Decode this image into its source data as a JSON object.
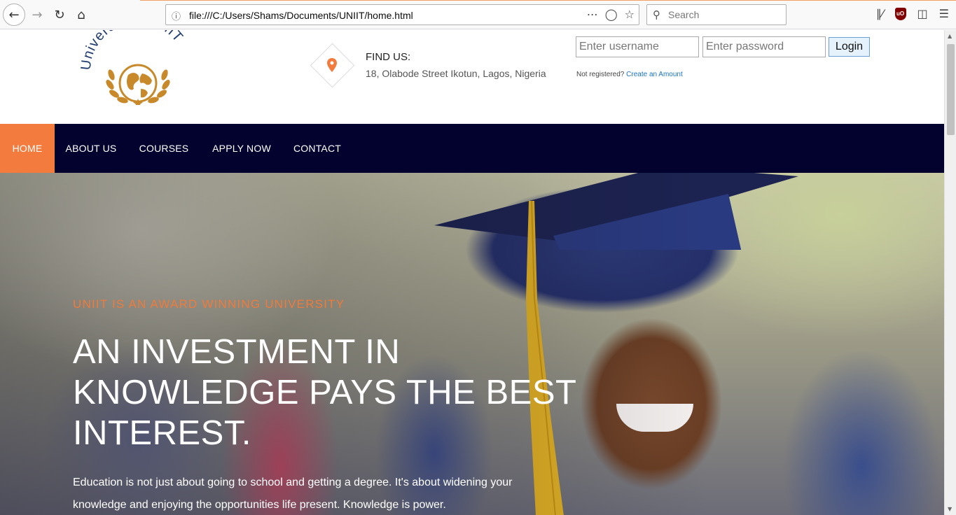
{
  "browser": {
    "url": "file:///C:/Users/Shams/Documents/UNIIT/home.html",
    "search_placeholder": "Search",
    "icons": [
      "back-icon",
      "forward-icon",
      "reload-icon",
      "home-icon",
      "info-icon",
      "more-icon",
      "pocket-icon",
      "star-icon",
      "search-icon",
      "library-icon",
      "ublock-icon",
      "sidebar-icon",
      "menu-icon"
    ]
  },
  "header": {
    "logo_text": "University of NIIT",
    "find_us_label": "FIND US:",
    "address": "18, Olabode Street Ikotun, Lagos, Nigeria",
    "username_placeholder": "Enter username",
    "password_placeholder": "Enter password",
    "login_label": "Login",
    "not_registered": "Not registered?",
    "create_account_link": "Create an Amount"
  },
  "nav": {
    "items": [
      {
        "label": "HOME",
        "active": true
      },
      {
        "label": "ABOUT US",
        "active": false
      },
      {
        "label": "COURSES",
        "active": false
      },
      {
        "label": "APPLY NOW",
        "active": false
      },
      {
        "label": "CONTACT",
        "active": false
      }
    ]
  },
  "hero": {
    "tagline": "UNIIT IS AN AWARD WINNING UNIVERSITY",
    "headline": "AN INVESTMENT IN KNOWLEDGE PAYS THE BEST INTEREST.",
    "description": "Education is not just about going to school and getting a degree. It's about widening your knowledge and enjoying the opportunities life present. Knowledge is power."
  },
  "colors": {
    "nav_bg": "#03022e",
    "accent": "#f47b3e",
    "link": "#1a73c8"
  }
}
